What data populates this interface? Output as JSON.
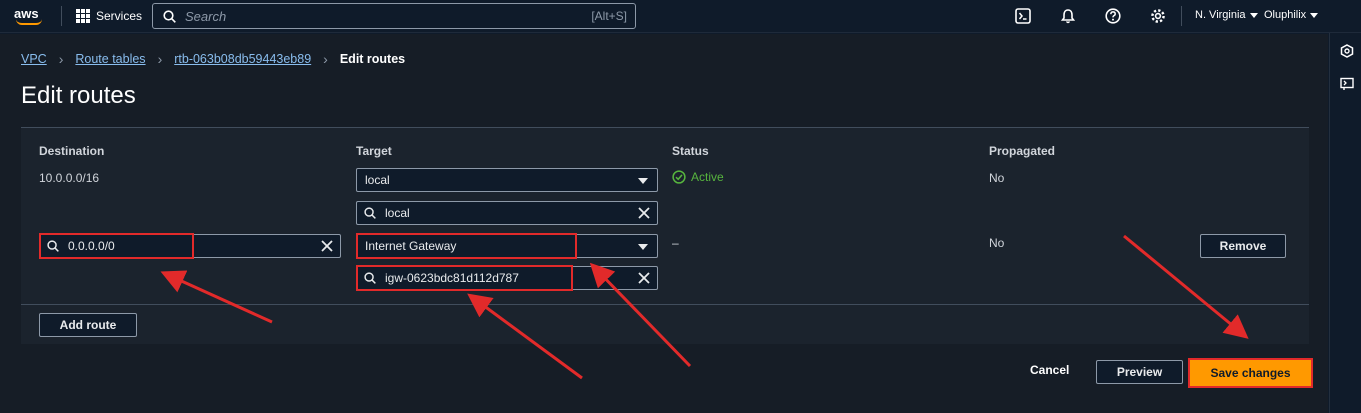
{
  "topbar": {
    "logo": "aws",
    "services": "Services",
    "search_placeholder": "Search",
    "search_shortcut": "[Alt+S]",
    "region": "N. Virginia",
    "user": "Oluphilix",
    "icons": [
      "cloudshell-icon",
      "bell-icon",
      "help-icon",
      "gear-icon"
    ]
  },
  "breadcrumb": [
    "VPC",
    "Route tables",
    "rtb-063b08db59443eb89",
    "Edit routes"
  ],
  "page_title": "Edit routes",
  "columns": [
    "Destination",
    "Target",
    "Status",
    "Propagated"
  ],
  "route1": {
    "destination": "10.0.0.0/16",
    "target_type": "local",
    "target_value": "local",
    "status": "Active",
    "propagated": "No"
  },
  "route2": {
    "destination": "0.0.0.0/0",
    "target_type": "Internet Gateway",
    "target_value": "igw-0623bdc81d112d787",
    "status": "–",
    "propagated": "No",
    "remove": "Remove"
  },
  "add_route": "Add route",
  "actions": {
    "cancel": "Cancel",
    "preview": "Preview",
    "save": "Save changes"
  },
  "colors": {
    "accent": "#ff9900",
    "link": "#89bdee",
    "success": "#57b53e",
    "annotation": "#e22a2a"
  }
}
